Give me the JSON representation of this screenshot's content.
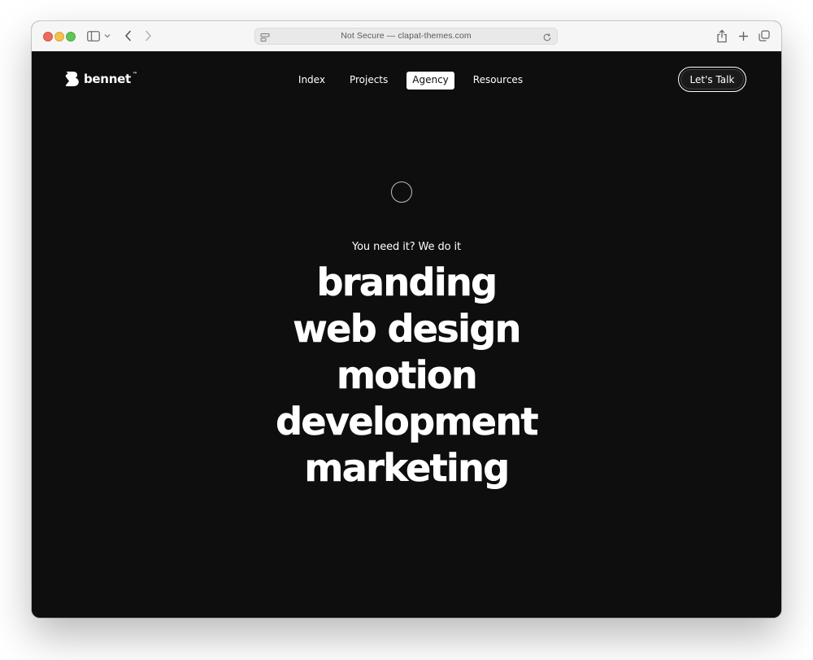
{
  "browser": {
    "address": "Not Secure — clapat-themes.com",
    "icons": {
      "sidebar": "sidebar-icon",
      "back": "chevron-left-icon",
      "forward": "chevron-right-icon",
      "share": "share-icon",
      "new_tab": "plus-icon",
      "tabs": "tab-overview-icon",
      "reload": "reload-icon"
    }
  },
  "site": {
    "logo_text": "bennet",
    "logo_tm": "™",
    "nav": [
      {
        "label": "Index",
        "active": false
      },
      {
        "label": "Projects",
        "active": false
      },
      {
        "label": "Agency",
        "active": true
      },
      {
        "label": "Resources",
        "active": false
      }
    ],
    "cta_label": "Let's Talk"
  },
  "hero": {
    "tagline": "You need it? We do it",
    "services": [
      "branding",
      "web design",
      "motion",
      "development",
      "marketing"
    ]
  },
  "colors": {
    "page_background": "#0e0e0e",
    "text": "#ffffff",
    "toolbar": "#f6f6f6"
  }
}
